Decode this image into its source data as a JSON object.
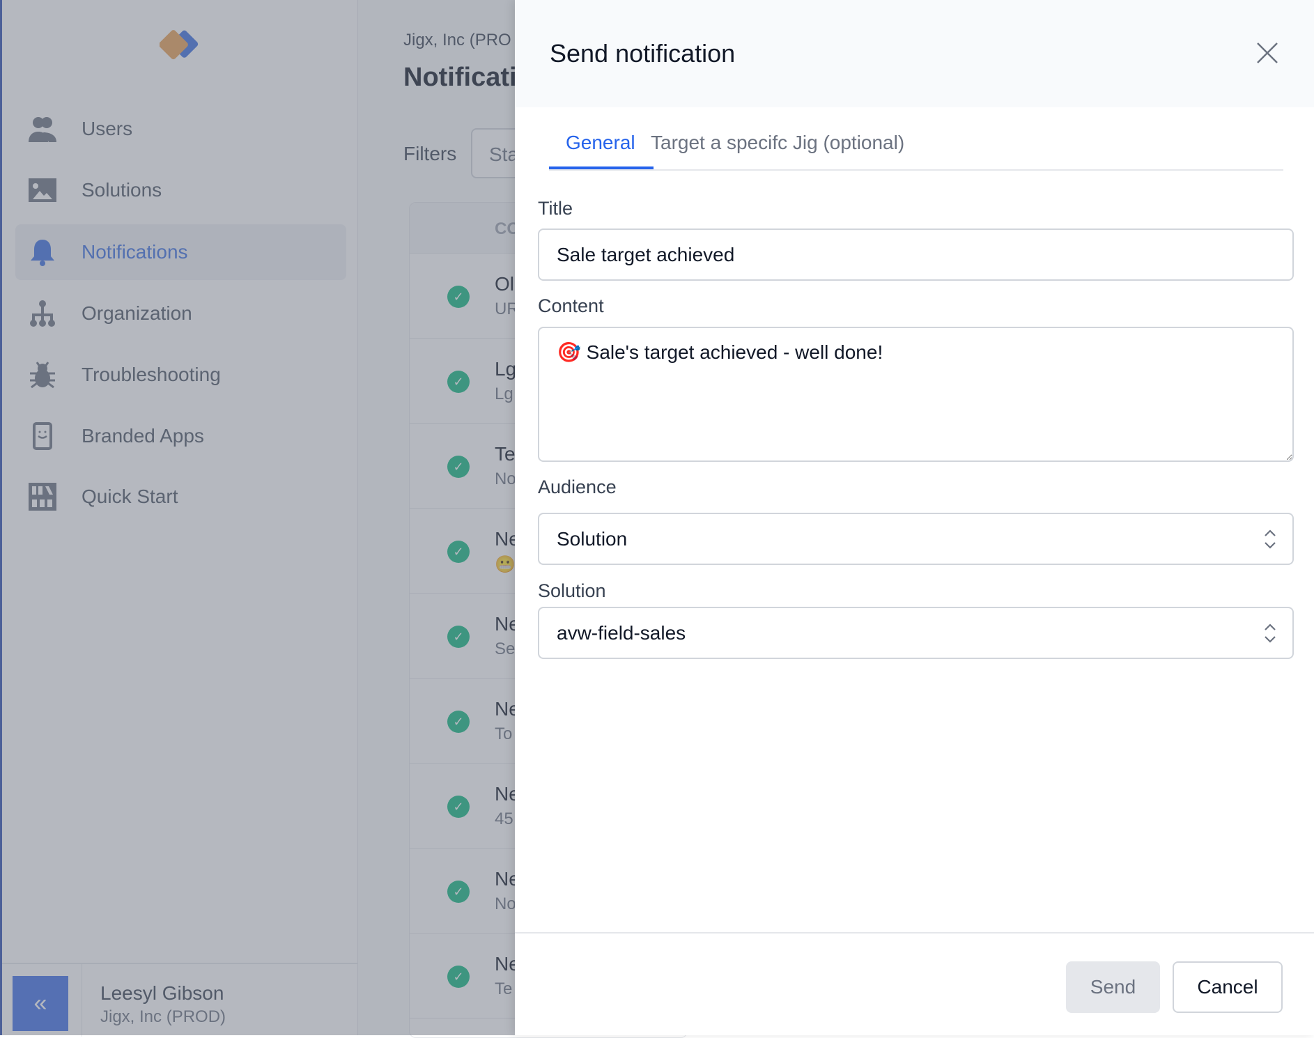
{
  "sidebar": {
    "items": [
      {
        "label": "Users",
        "icon": "users-icon"
      },
      {
        "label": "Solutions",
        "icon": "image-icon"
      },
      {
        "label": "Notifications",
        "icon": "bell-icon",
        "active": true
      },
      {
        "label": "Organization",
        "icon": "org-chart-icon"
      },
      {
        "label": "Troubleshooting",
        "icon": "bug-icon"
      },
      {
        "label": "Branded Apps",
        "icon": "phone-smile-icon"
      },
      {
        "label": "Quick Start",
        "icon": "grid-icon"
      }
    ],
    "collapse_label": "«",
    "user": {
      "name": "Leesyl Gibson",
      "org": "Jigx, Inc (PROD)"
    }
  },
  "main": {
    "org": "Jigx, Inc (PRO",
    "title": "Notificati",
    "filters_label": "Filters",
    "filter_value": "Sta",
    "table_header": "CO",
    "rows": [
      {
        "title": "Ol",
        "sub": "UR"
      },
      {
        "title": "Lg",
        "sub": "Lg"
      },
      {
        "title": "Te",
        "sub": "No"
      },
      {
        "title": "Ne",
        "sub": "😬"
      },
      {
        "title": "Ne",
        "sub": "Se"
      },
      {
        "title": "Ne",
        "sub": "To"
      },
      {
        "title": "Ne",
        "sub": "45"
      },
      {
        "title": "Ne",
        "sub": "No"
      },
      {
        "title": "Ne",
        "sub": "Te"
      }
    ]
  },
  "panel": {
    "title": "Send notification",
    "tabs": [
      {
        "label": "General",
        "active": true
      },
      {
        "label": "Target a specifc Jig (optional)"
      }
    ],
    "fields": {
      "title_label": "Title",
      "title_value": "Sale target achieved",
      "content_label": "Content",
      "content_value": "🎯 Sale's target achieved - well done!",
      "audience_label": "Audience",
      "audience_value": "Solution",
      "solution_label": "Solution",
      "solution_value": "avw-field-sales"
    },
    "send_label": "Send",
    "cancel_label": "Cancel"
  },
  "colors": {
    "accent": "#2563eb",
    "success": "#10b981",
    "logo_orange": "#e8a055",
    "logo_blue": "#3b6fe0"
  }
}
